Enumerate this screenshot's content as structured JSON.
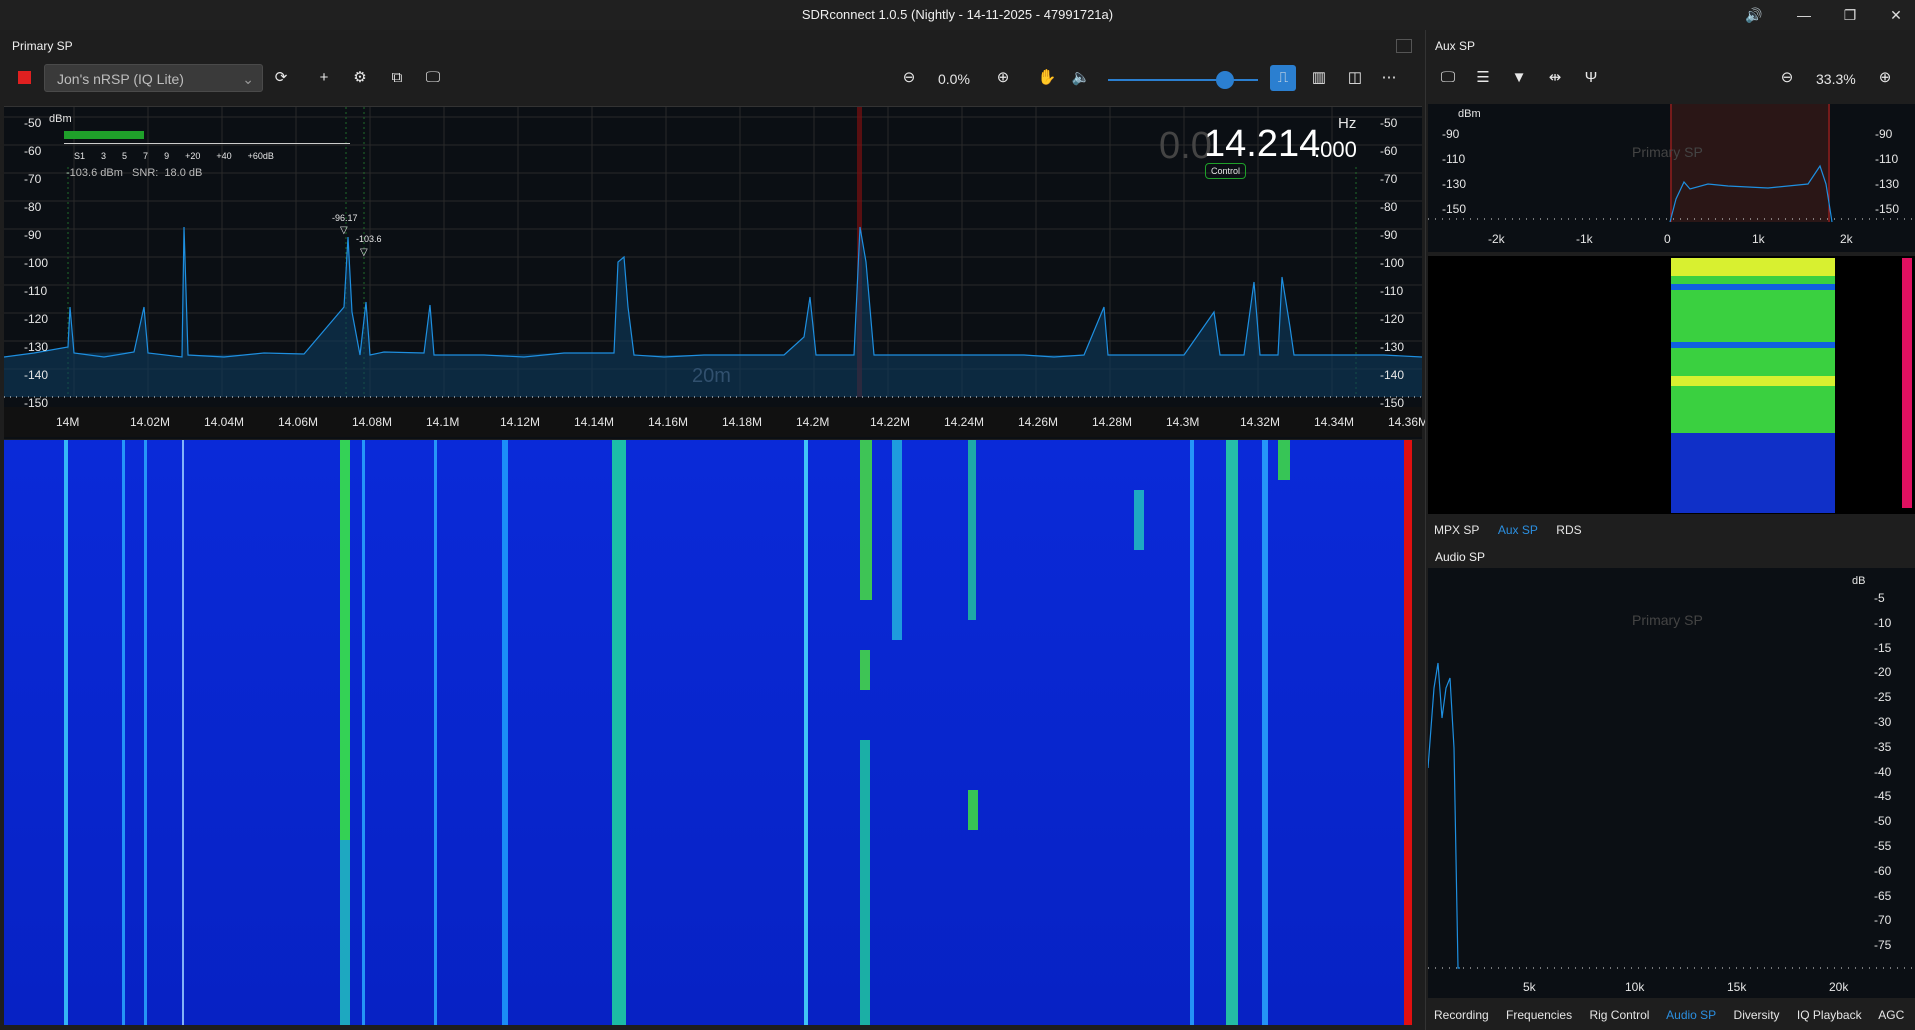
{
  "window": {
    "title": "SDRconnect 1.0.5 (Nightly - 14-11-2025 - 47991721a)"
  },
  "primary": {
    "panel_title": "Primary SP",
    "device": "Jon's nRSP (IQ Lite)",
    "zoom": "0.0%",
    "frequency_faded": "0.0",
    "frequency_main": "14.214",
    "frequency_small": ".000",
    "hz_label": "Hz",
    "control_badge": "Control",
    "band_label": "20m",
    "dbm_label": "dBm",
    "meter_scale": [
      "S1",
      "3",
      "5",
      "7",
      "9",
      "+20",
      "+40",
      "+60dB"
    ],
    "meter_readout": "-103.6 dBm   SNR:  18.0 dB",
    "marker1": "-96.17",
    "marker2": "-103.6",
    "y_ticks": [
      "-50",
      "-60",
      "-70",
      "-80",
      "-90",
      "-100",
      "-110",
      "-120",
      "-130",
      "-140",
      "-150"
    ],
    "x_ticks": [
      "14M",
      "14.02M",
      "14.04M",
      "14.06M",
      "14.08M",
      "14.1M",
      "14.12M",
      "14.14M",
      "14.16M",
      "14.18M",
      "14.2M",
      "14.22M",
      "14.24M",
      "14.26M",
      "14.28M",
      "14.3M",
      "14.32M",
      "14.34M",
      "14.36M"
    ]
  },
  "aux": {
    "panel_title": "Aux SP",
    "zoom": "33.3%",
    "dbm_label": "dBm",
    "watermark": "Primary SP",
    "y_ticks": [
      "-90",
      "-110",
      "-130",
      "-150"
    ],
    "x_ticks": [
      "-2k",
      "-1k",
      "0",
      "1k",
      "2k"
    ],
    "tabs": [
      "MPX SP",
      "Aux SP",
      "RDS"
    ]
  },
  "audio": {
    "panel_title": "Audio SP",
    "db_label": "dB",
    "watermark": "Primary SP",
    "y_ticks": [
      "-5",
      "-10",
      "-15",
      "-20",
      "-25",
      "-30",
      "-35",
      "-40",
      "-45",
      "-50",
      "-55",
      "-60",
      "-65",
      "-70",
      "-75"
    ],
    "x_ticks": [
      "5k",
      "10k",
      "15k",
      "20k"
    ]
  },
  "bottom_tabs": [
    "Recording",
    "Frequencies",
    "Rig Control",
    "Audio SP",
    "Diversity",
    "IQ Playback",
    "AGC"
  ],
  "colors": {
    "accent": "#2b7fd0",
    "trace": "#1e8fe0",
    "waterfall_bg": "#0a24d4",
    "record": "#e02020"
  }
}
